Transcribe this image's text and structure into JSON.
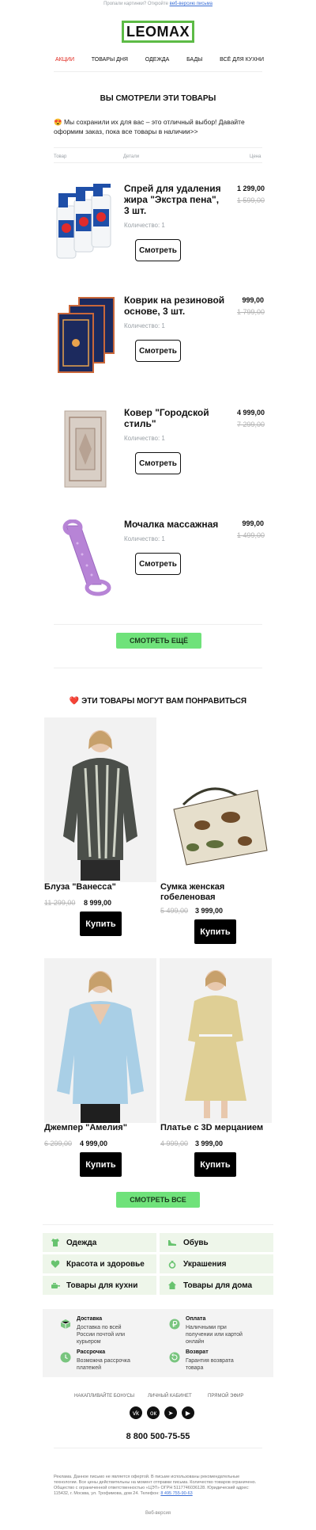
{
  "header": {
    "preview_text": "Пропали картинки? Откройте ",
    "preview_link": "веб-версию письма",
    "logo": "LEOMAX"
  },
  "nav": {
    "items": [
      "АКЦИИ",
      "ТОВАРЫ ДНЯ",
      "ОДЕЖДА",
      "БАДЫ",
      "ВСЁ ДЛЯ КУХНИ"
    ]
  },
  "viewed": {
    "title": "ВЫ СМОТРЕЛИ ЭТИ ТОВАРЫ",
    "intro": "😍 Мы сохранили их для вас – это отличный выбор! Давайте оформим заказ, пока все товары в наличии>>",
    "col_product": "Товар",
    "col_details": "Детали",
    "col_price": "Цена",
    "items": [
      {
        "name": "Спрей для удаления жира \"Экстра пена\", 3 шт.",
        "qty": "Количество: 1",
        "price": "1 299,00",
        "old_price": "1 599,00",
        "button": "Смотреть"
      },
      {
        "name": "Коврик на резиновой основе, 3 шт.",
        "qty": "Количество: 1",
        "price": "999,00",
        "old_price": "1 799,00",
        "button": "Смотреть"
      },
      {
        "name": "Ковер \"Городской стиль\"",
        "qty": "Количество: 1",
        "price": "4 999,00",
        "old_price": "7 299,00",
        "button": "Смотреть"
      },
      {
        "name": "Мочалка массажная",
        "qty": "Количество: 1",
        "price": "999,00",
        "old_price": "1 499,00",
        "button": "Смотреть"
      }
    ],
    "more_button": "СМОТРЕТЬ ЕЩЁ"
  },
  "recommend": {
    "title": "❤️ ЭТИ ТОВАРЫ МОГУТ ВАМ ПОНРАВИТЬСЯ",
    "products": [
      {
        "name": "Блуза \"Ванесса\"",
        "old_price": "11 299,00",
        "price": "8 999,00",
        "button": "Купить"
      },
      {
        "name": "Сумка женская гобеленовая",
        "old_price": "5 499,00",
        "price": "3 999,00",
        "button": "Купить"
      },
      {
        "name": "Джемпер \"Амелия\"",
        "old_price": "6 299,00",
        "price": "4 999,00",
        "button": "Купить"
      },
      {
        "name": "Платье с 3D мерцанием",
        "old_price": "4 999,00",
        "price": "3 999,00",
        "button": "Купить"
      }
    ],
    "all_button": "СМОТРЕТЬ ВСЕ"
  },
  "categories": [
    {
      "label": "Одежда",
      "icon": "shirt-icon"
    },
    {
      "label": "Обувь",
      "icon": "shoe-icon"
    },
    {
      "label": "Красота и здоровье",
      "icon": "heart-icon"
    },
    {
      "label": "Украшения",
      "icon": "ring-icon"
    },
    {
      "label": "Товары для кухни",
      "icon": "pan-icon"
    },
    {
      "label": "Товары для дома",
      "icon": "house-icon"
    }
  ],
  "benefits": [
    {
      "title": "Доставка",
      "text": "Доставка по всей России почтой или курьером",
      "icon": "box-icon"
    },
    {
      "title": "Оплата",
      "text": "Наличными при получении или картой онлайн",
      "icon": "ruble-icon"
    },
    {
      "title": "Рассрочка",
      "text": "Возможна рассрочка платежей",
      "icon": "clock-icon"
    },
    {
      "title": "Возврат",
      "text": "Гарантия возврата товара",
      "icon": "return-icon"
    }
  ],
  "footer_links": [
    "НАКАПЛИВАЙТЕ БОНУСЫ",
    "ЛИЧНЫЙ КАБИНЕТ",
    "ПРЯМОЙ ЭФИР"
  ],
  "social": [
    {
      "icon": "vk-icon",
      "glyph": "vk"
    },
    {
      "icon": "ok-icon",
      "glyph": "ок"
    },
    {
      "icon": "telegram-icon",
      "glyph": "➤"
    },
    {
      "icon": "youtube-icon",
      "glyph": "▶"
    }
  ],
  "phone": "8 800 500-75-55",
  "legal": "Реклама. Данное письмо не является офертой. В письме использованы рекомендательные технологии. Все цены действительны на момент отправки письма. Количество товаров ограничено. Общество с ограниченной ответственностью «ЦЭТ» ОГРН 5117746036128. Юридический адрес: 115432, г. Москва, ул. Трофимова, дом 24. Телефон: ",
  "legal_phone": "8 495 755-90-63",
  "web_link": "Веб-версия",
  "colors": {
    "brand_green": "#6fe27a",
    "logo_green": "#5dbb46",
    "nav_active": "#e0261d",
    "category_bg": "#eef6ea"
  }
}
